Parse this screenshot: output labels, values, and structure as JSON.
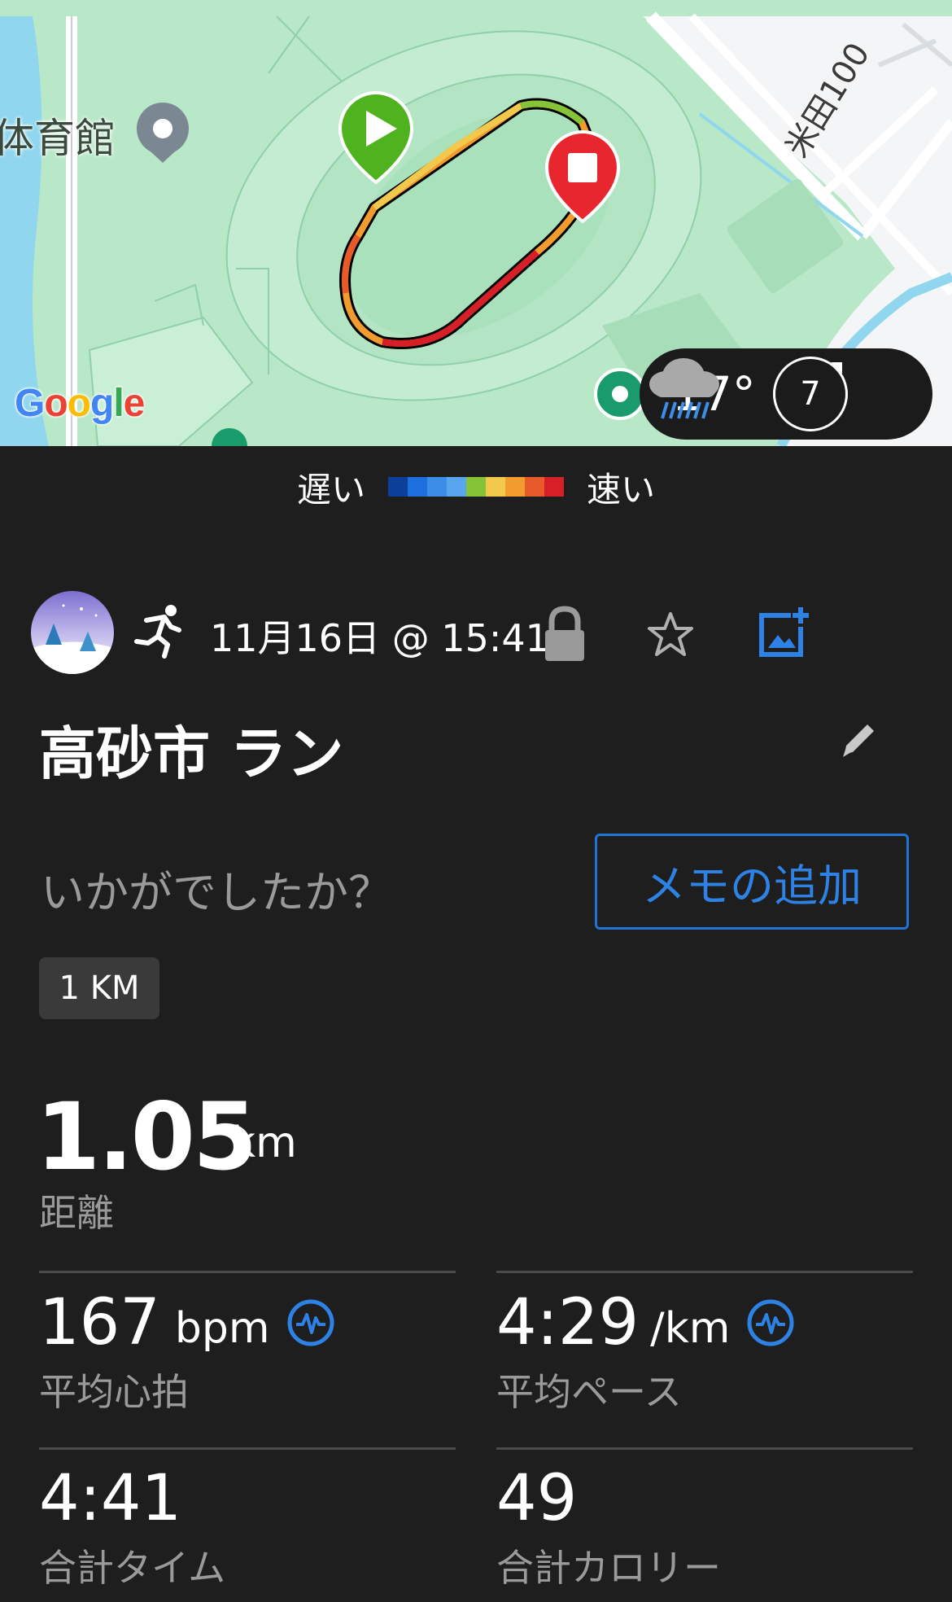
{
  "map": {
    "place_label_left": "体育館",
    "road_label": "米田100",
    "google_logo": "Google",
    "weather": {
      "temperature": "17°",
      "condition_icon": "rain-cloud-icon",
      "wind_speed": "7"
    }
  },
  "legend": {
    "slow": "遅い",
    "fast": "速い",
    "colors": [
      "#0b3f9a",
      "#1d6fe0",
      "#3c8de8",
      "#5aa6ee",
      "#86c437",
      "#f2c94c",
      "#f29b2e",
      "#e95a2a",
      "#d61f26"
    ]
  },
  "activity": {
    "avatar_icon": "snowy-forest-avatar",
    "type_icon": "running-icon",
    "datetime": "11月16日 @ 15:41",
    "title": "高砂市 ラン",
    "prompt": "いかがでしたか？",
    "memo_button": "メモの追加",
    "tag": "1 KM"
  },
  "distance": {
    "value": "1.05",
    "unit": "km",
    "label": "距離"
  },
  "stats": {
    "avg_hr": {
      "value": "167",
      "unit": "bpm",
      "label": "平均心拍"
    },
    "avg_pace": {
      "value": "4:29",
      "unit": "/km",
      "label": "平均ペース"
    },
    "total_time": {
      "value": "4:41",
      "label": "合計タイム"
    },
    "calories": {
      "value": "49",
      "label": "合計カロリー"
    }
  }
}
